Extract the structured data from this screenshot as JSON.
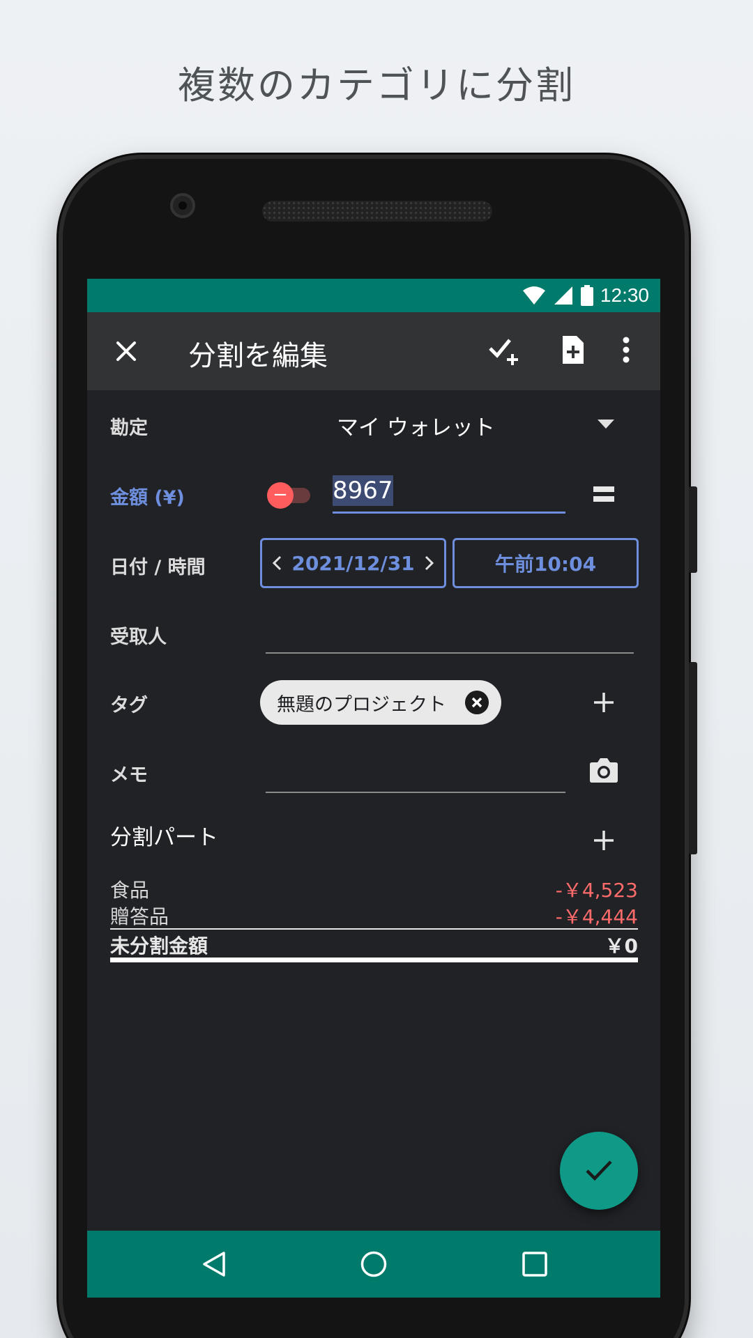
{
  "headline": "複数のカテゴリに分割",
  "status_bar": {
    "time": "12:30"
  },
  "toolbar": {
    "title": "分割を編集",
    "close_icon": "close-icon",
    "check_add_icon": "check-add-icon",
    "new_document_icon": "new-document-icon",
    "more_icon": "more-vert-icon"
  },
  "form": {
    "account_label": "勘定",
    "account_value": "マイ ウォレット",
    "amount_label": "金額 (¥)",
    "amount_value": "8967",
    "datetime_label": "日付 / 時間",
    "date_value": "2021/12/31",
    "time_value": "午前10:04",
    "payee_label": "受取人",
    "tags_label": "タグ",
    "tag_chip": "無題のプロジェクト",
    "memo_label": "メモ"
  },
  "splits": {
    "title": "分割パート",
    "items": [
      {
        "name": "食品",
        "amount": "-￥4,523"
      },
      {
        "name": "贈答品",
        "amount": "-￥4,444"
      }
    ],
    "unsplit_label": "未分割金額",
    "unsplit_amount": "￥0"
  },
  "colors": {
    "status_bar": "#007a6b",
    "accent": "#6d8fde",
    "negative": "#ff6b6b",
    "fab": "#0f9a88"
  }
}
